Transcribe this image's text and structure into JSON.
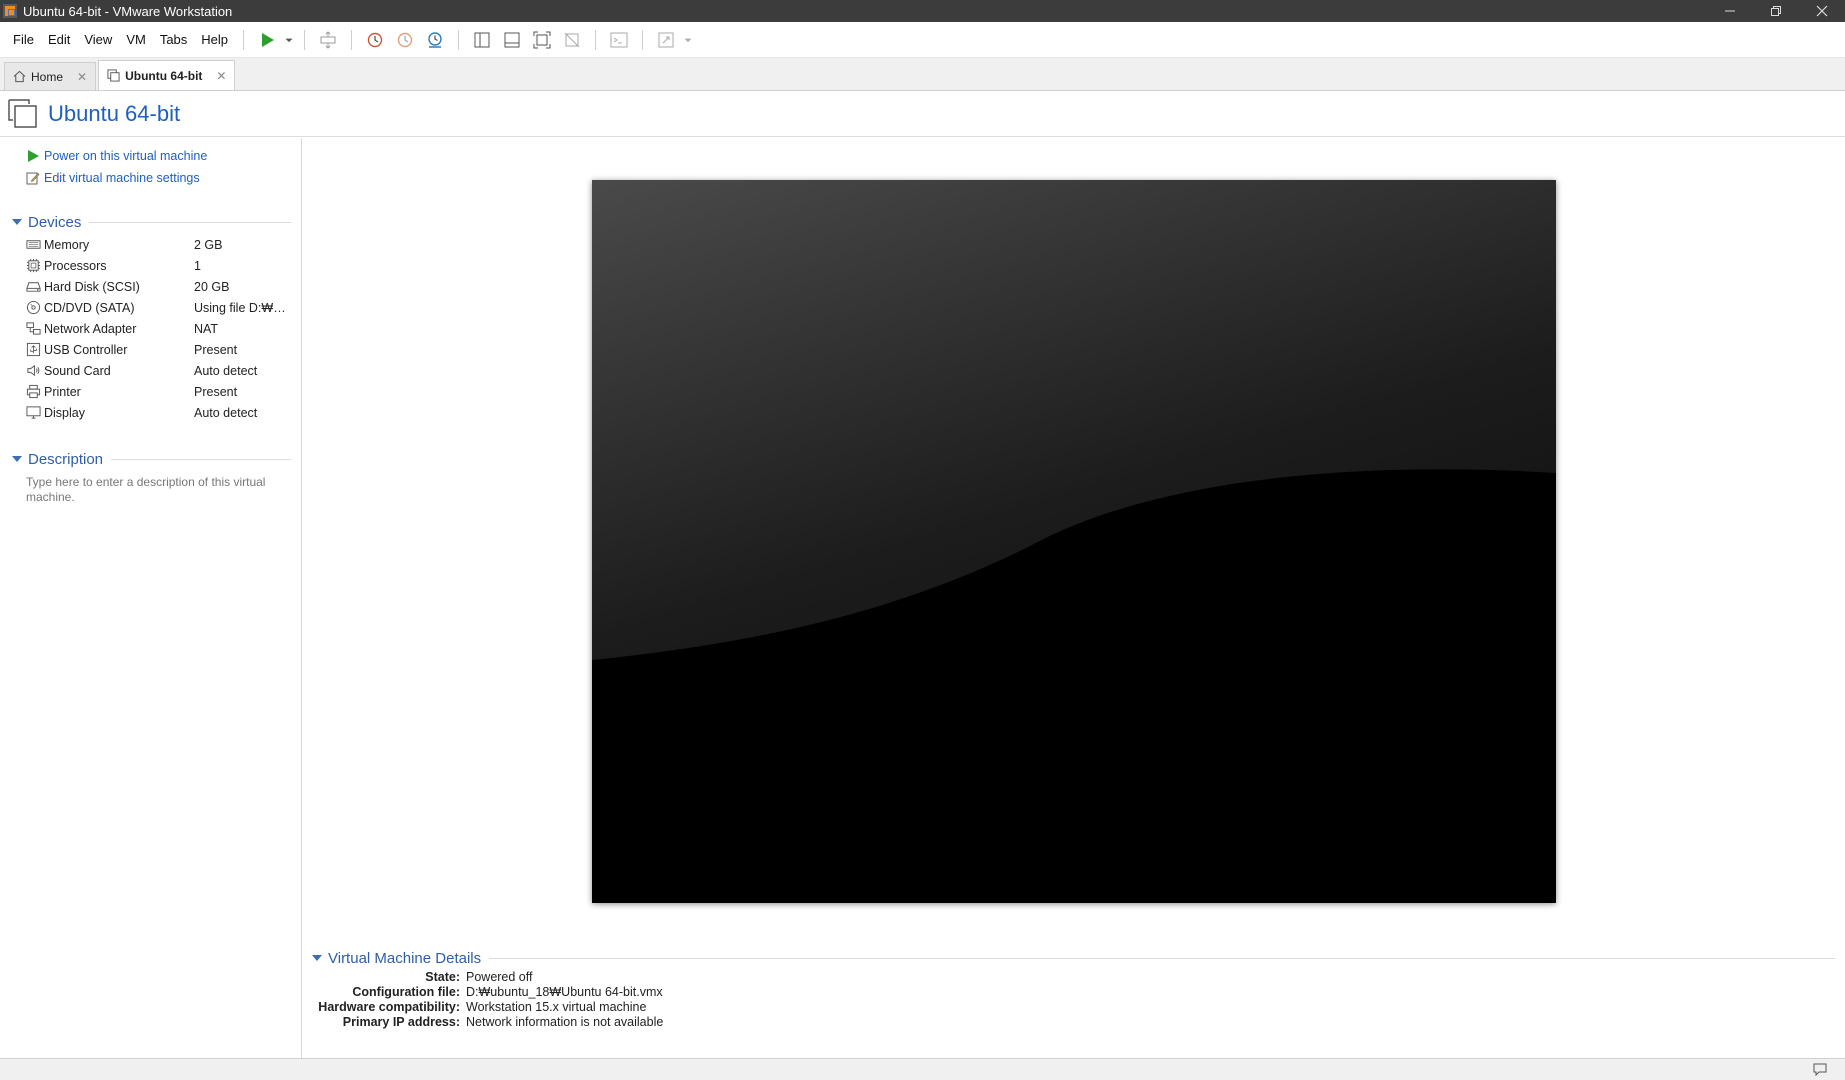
{
  "window": {
    "title": "Ubuntu 64-bit - VMware Workstation",
    "controls": [
      "minimize",
      "restore",
      "close"
    ]
  },
  "menu": {
    "items": [
      "File",
      "Edit",
      "View",
      "VM",
      "Tabs",
      "Help"
    ]
  },
  "toolbar": {
    "icons": [
      "play-icon",
      "dropdown-icon",
      "send-ctrl-alt-del-icon",
      "snapshot-icon",
      "revert-snapshot-icon",
      "snapshot-manager-icon",
      "library-view-icon",
      "thumbnail-view-icon",
      "fullscreen-icon",
      "unity-icon",
      "console-icon",
      "stretch-icon"
    ]
  },
  "tabs": [
    {
      "label": "Home",
      "active": false
    },
    {
      "label": "Ubuntu 64-bit",
      "active": true
    }
  ],
  "vm": {
    "title": "Ubuntu 64-bit"
  },
  "actions": {
    "power_on": "Power on this virtual machine",
    "edit_settings": "Edit virtual machine settings"
  },
  "devices": {
    "heading": "Devices",
    "items": [
      {
        "name": "Memory",
        "value": "2 GB",
        "icon": "memory-icon"
      },
      {
        "name": "Processors",
        "value": "1",
        "icon": "processor-icon"
      },
      {
        "name": "Hard Disk (SCSI)",
        "value": "20 GB",
        "icon": "hard-disk-icon"
      },
      {
        "name": "CD/DVD (SATA)",
        "value": "Using file D:₩Cl...",
        "icon": "cd-dvd-icon"
      },
      {
        "name": "Network Adapter",
        "value": "NAT",
        "icon": "network-icon"
      },
      {
        "name": "USB Controller",
        "value": "Present",
        "icon": "usb-icon"
      },
      {
        "name": "Sound Card",
        "value": "Auto detect",
        "icon": "sound-icon"
      },
      {
        "name": "Printer",
        "value": "Present",
        "icon": "printer-icon"
      },
      {
        "name": "Display",
        "value": "Auto detect",
        "icon": "display-icon"
      }
    ]
  },
  "description": {
    "heading": "Description",
    "placeholder": "Type here to enter a description of this virtual machine."
  },
  "details": {
    "heading": "Virtual Machine Details",
    "rows": [
      {
        "key": "State:",
        "value": "Powered off"
      },
      {
        "key": "Configuration file:",
        "value": "D:₩ubuntu_18₩Ubuntu 64-bit.vmx"
      },
      {
        "key": "Hardware compatibility:",
        "value": "Workstation 15.x virtual machine"
      },
      {
        "key": "Primary IP address:",
        "value": "Network information is not available"
      }
    ]
  },
  "colors": {
    "titlebar": "#3c3c3c",
    "accent_blue": "#1f5fbf",
    "play_green": "#2e9e2e"
  }
}
